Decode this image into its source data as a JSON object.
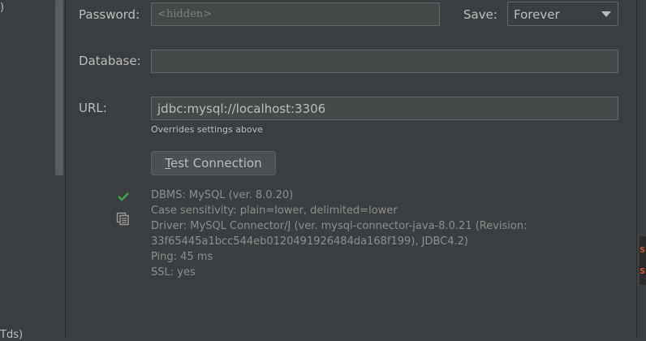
{
  "left_panel": {
    "fragment_top": ")",
    "fragment_bottom": "Tds)"
  },
  "right_strip": {
    "marks": [
      "s",
      "s"
    ]
  },
  "form": {
    "password": {
      "label": "Password:",
      "placeholder": "<hidden>"
    },
    "save": {
      "label": "Save:",
      "selected": "Forever"
    },
    "database": {
      "label": "Database:",
      "value": ""
    },
    "url": {
      "label": "URL:",
      "value": "jdbc:mysql://localhost:3306",
      "hint": "Overrides settings above"
    },
    "test_button": {
      "mnemonic": "T",
      "label_rest": "est Connection"
    }
  },
  "connection_info": {
    "status_icon": "check-icon",
    "copy_icon": "copy-icon",
    "lines": [
      "DBMS: MySQL (ver. 8.0.20)",
      "Case sensitivity: plain=lower, delimited=lower",
      "Driver: MySQL Connector/J (ver. mysql-connector-java-8.0.21 (Revision:",
      "33f65445a1bcc544eb0120491926484da168f199), JDBC4.2)",
      "Ping: 45 ms",
      "SSL: yes"
    ]
  },
  "colors": {
    "background": "#3c3f41",
    "field_bg": "#45494a",
    "border": "#646464",
    "text": "#bbbbbb",
    "muted_text": "#8c8c8c",
    "success": "#499c54",
    "error_mark": "#cc5d2f"
  }
}
